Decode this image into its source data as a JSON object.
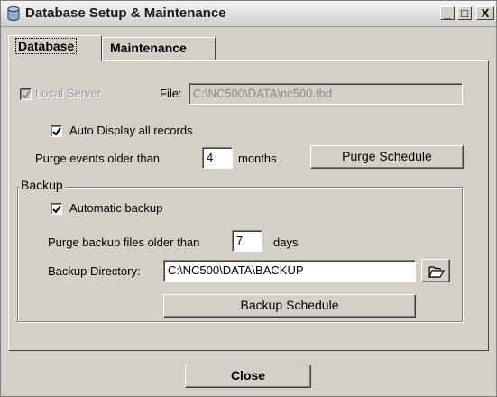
{
  "window": {
    "title": "Database Setup & Maintenance",
    "minimize_label": "_",
    "maximize_label": "□",
    "close_label": "X"
  },
  "tabs": [
    {
      "label": "Database",
      "active": true
    },
    {
      "label": "Maintenance",
      "active": false
    }
  ],
  "database": {
    "local_server_label": "Local Server",
    "local_server_checked": true,
    "local_server_enabled": false,
    "file_label": "File:",
    "file_value": "C:\\NC500\\DATA\\nc500.fbd",
    "auto_display_label": "Auto Display all records",
    "auto_display_checked": true,
    "purge_events_label": "Purge events older than",
    "purge_events_value": "4",
    "purge_events_unit": "months",
    "purge_schedule_label": "Purge Schedule"
  },
  "backup": {
    "group_label": "Backup",
    "automatic_label": "Automatic backup",
    "automatic_checked": true,
    "purge_backup_label": "Purge backup files older than",
    "purge_backup_value": "7",
    "purge_backup_unit": "days",
    "directory_label": "Backup Directory:",
    "directory_value": "C:\\NC500\\DATA\\BACKUP",
    "backup_schedule_label": "Backup Schedule"
  },
  "footer": {
    "close_label": "Close"
  },
  "icons": {
    "app": "database-icon",
    "browse": "folder-open-icon"
  }
}
